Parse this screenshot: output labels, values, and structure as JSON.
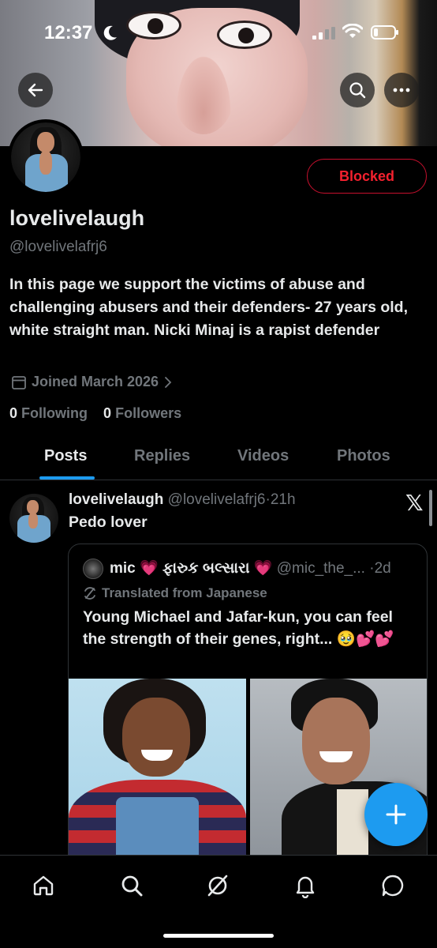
{
  "status_bar": {
    "time": "12:37"
  },
  "profile": {
    "display_name": "lovelivelaugh",
    "handle": "@lovelivelafrj6",
    "bio": "In this page we support the victims of abuse and challenging abusers and their defenders- 27 years old, white straight man. Nicki Minaj is a rapist defender",
    "joined": "Joined March 2026",
    "following_count": "0",
    "following_label": "Following",
    "followers_count": "0",
    "followers_label": "Followers",
    "blocked_label": "Blocked"
  },
  "tabs": [
    {
      "label": "Posts",
      "active": true
    },
    {
      "label": "Replies",
      "active": false
    },
    {
      "label": "Videos",
      "active": false
    },
    {
      "label": "Photos",
      "active": false
    }
  ],
  "post": {
    "author_name": "lovelivelaugh",
    "author_handle": "@lovelivelafrj6",
    "separator": "·",
    "time": "21h",
    "text": "Pedo lover",
    "quote": {
      "author_name": "mic",
      "author_name_extra": "ફારુક બલ્સારા",
      "author_handle": "@mic_the_...",
      "separator": "·",
      "time": "2d",
      "translated_label": "Translated from Japanese",
      "text": "Young Michael and Jafar-kun, you can feel the strength of their genes, right... 🥹💕💕"
    }
  },
  "colors": {
    "accent": "#1d9bf0",
    "blocked": "#f4212e",
    "muted": "#71767b",
    "background": "#000000"
  },
  "icons": {
    "back": "arrow-left-icon",
    "search": "search-icon",
    "more": "more-horizontal-icon",
    "x_logo": "x-logo-icon",
    "fab": "plus-icon",
    "nav": [
      "home-icon",
      "search-icon",
      "grok-icon",
      "bell-icon",
      "message-icon"
    ]
  }
}
